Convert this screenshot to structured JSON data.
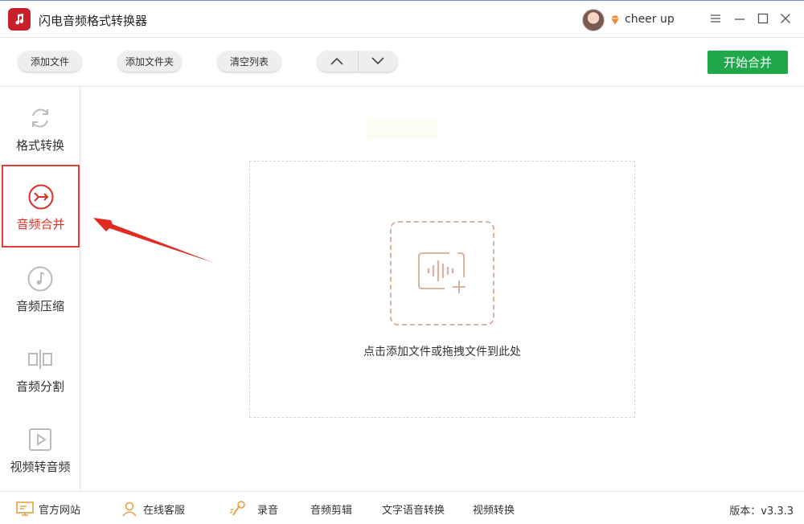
{
  "app": {
    "title": "闪电音频格式转换器"
  },
  "user": {
    "name": "cheer up"
  },
  "toolbar": {
    "add_file": "添加文件",
    "add_folder": "添加文件夹",
    "clear_list": "清空列表",
    "start": "开始合并"
  },
  "sidebar": {
    "items": [
      {
        "label": "格式转换",
        "icon": "refresh-icon"
      },
      {
        "label": "音频合并",
        "icon": "merge-icon",
        "active": true
      },
      {
        "label": "音频压缩",
        "icon": "music-note-icon"
      },
      {
        "label": "音频分割",
        "icon": "split-icon"
      },
      {
        "label": "视频转音频",
        "icon": "play-icon"
      }
    ]
  },
  "main": {
    "drop_hint": "点击添加文件或拖拽文件到此处"
  },
  "footer": {
    "website": "官方网站",
    "support": "在线客服",
    "record": "录音",
    "audio_edit": "音频剪辑",
    "tts": "文字语音转换",
    "video_convert": "视频转换",
    "version": "版本：v3.3.3"
  },
  "colors": {
    "accent_red": "#d9302a",
    "start_green": "#1ea84a",
    "drop_border": "#d8b3a0"
  }
}
